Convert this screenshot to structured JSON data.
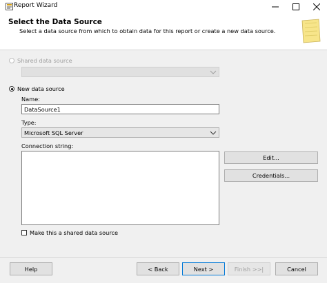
{
  "window": {
    "title": "Report Wizard"
  },
  "header": {
    "title": "Select the Data Source",
    "subtitle": "Select a data source from which to obtain data for this report or create a new data source."
  },
  "shared_source": {
    "label": "Shared data source",
    "selected": false,
    "dropdown_value": ""
  },
  "new_source": {
    "label": "New data source",
    "selected": true,
    "name_label": "Name:",
    "name_value": "DataSource1",
    "type_label": "Type:",
    "type_value": "Microsoft SQL Server",
    "conn_label": "Connection string:",
    "conn_value": "",
    "edit_label": "Edit...",
    "credentials_label": "Credentials...",
    "make_shared_label": "Make this a shared data source",
    "make_shared_checked": false
  },
  "footer": {
    "help": "Help",
    "back": "< Back",
    "next": "Next >",
    "finish": "Finish >>|",
    "cancel": "Cancel"
  },
  "colors": {
    "panel": "#f0f0f0",
    "button": "#e1e1e1",
    "border": "#adadad"
  }
}
